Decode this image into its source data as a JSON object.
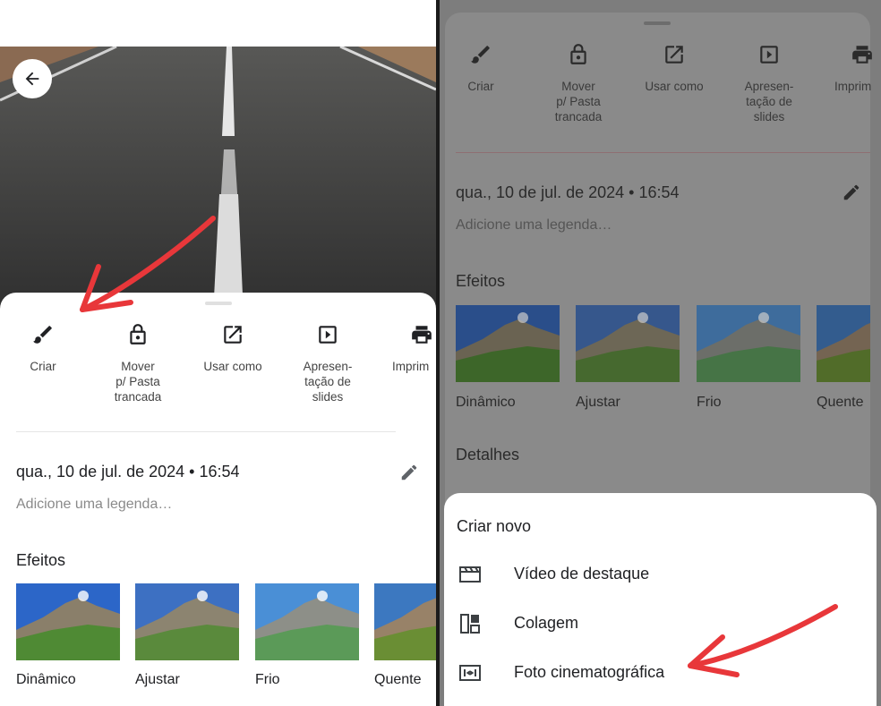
{
  "left": {
    "actions": [
      {
        "label": "Criar",
        "icon": "brush-icon"
      },
      {
        "label": "Mover\np/ Pasta\ntrancada",
        "icon": "lock-icon"
      },
      {
        "label": "Usar como",
        "icon": "open-external-icon"
      },
      {
        "label": "Apresen-\ntação de\nslides",
        "icon": "slideshow-icon"
      },
      {
        "label": "Imprim",
        "icon": "print-icon"
      }
    ],
    "date": "qua., 10 de jul. de 2024  •  16:54",
    "caption_placeholder": "Adicione uma legenda…",
    "effects_title": "Efeitos",
    "effects": [
      "Dinâmico",
      "Ajustar",
      "Frio",
      "Quente"
    ]
  },
  "right": {
    "actions": [
      {
        "label": "Criar",
        "icon": "brush-icon"
      },
      {
        "label": "Mover\np/ Pasta\ntrancada",
        "icon": "lock-icon"
      },
      {
        "label": "Usar como",
        "icon": "open-external-icon"
      },
      {
        "label": "Apresen-\ntação de\nslides",
        "icon": "slideshow-icon"
      },
      {
        "label": "Imprim",
        "icon": "print-icon"
      }
    ],
    "date": "qua., 10 de jul. de 2024  •  16:54",
    "caption_placeholder": "Adicione uma legenda…",
    "effects_title": "Efeitos",
    "effects": [
      "Dinâmico",
      "Ajustar",
      "Frio",
      "Quente"
    ],
    "details_title": "Detalhes",
    "create_new": {
      "title": "Criar novo",
      "items": [
        {
          "label": "Vídeo de destaque",
          "icon": "clapperboard-icon"
        },
        {
          "label": "Colagem",
          "icon": "collage-icon"
        },
        {
          "label": "Foto cinematográfica",
          "icon": "cinematic-photo-icon"
        }
      ]
    }
  },
  "colors": {
    "arrow": "#e8373a",
    "text": "#202124",
    "muted": "#8a8a8a"
  }
}
